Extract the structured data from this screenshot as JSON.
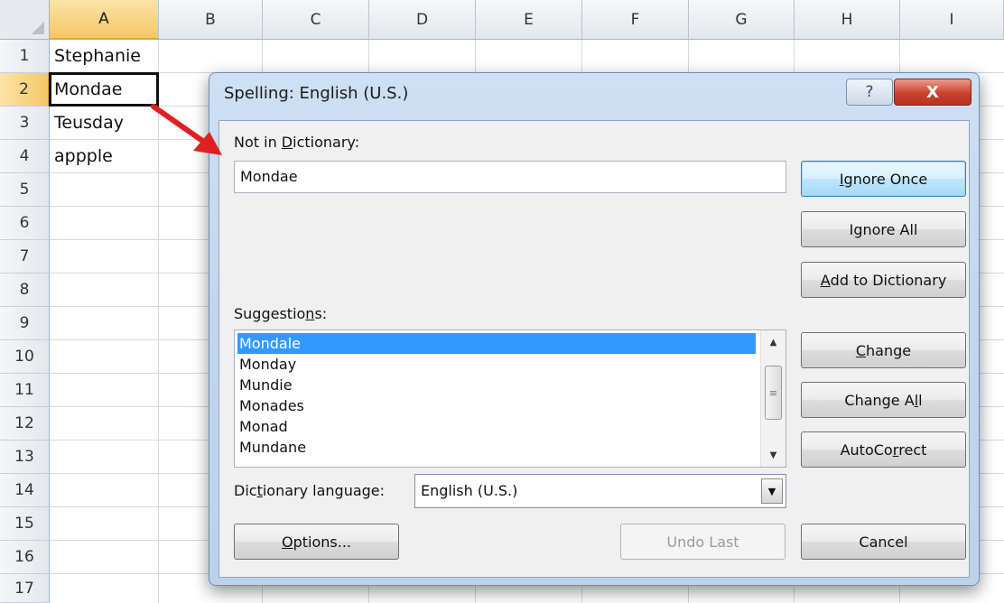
{
  "sheet": {
    "columns": [
      "A",
      "B",
      "C",
      "D",
      "E",
      "F",
      "G",
      "H",
      "I"
    ],
    "rows": [
      "1",
      "2",
      "3",
      "4",
      "5",
      "6",
      "7",
      "8",
      "9",
      "10",
      "11",
      "12",
      "13",
      "14",
      "15",
      "16",
      "17"
    ],
    "cells": {
      "a1": "Stephanie",
      "a2": "Mondae",
      "a3": "Teusday",
      "a4": "appple"
    }
  },
  "dialog": {
    "title": "Spelling: English (U.S.)",
    "help_glyph": "?",
    "close_glyph": "X",
    "not_in_dictionary_label": {
      "pre": "Not in ",
      "u": "D",
      "post": "ictionary:"
    },
    "not_in_dictionary_value": "Mondae",
    "suggestions_label": {
      "pre": "Suggestio",
      "u": "n",
      "post": "s:"
    },
    "suggestions": [
      "Mondale",
      "Monday",
      "Mundie",
      "Monades",
      "Monad",
      "Mundane"
    ],
    "selected_suggestion": "Mondale",
    "dictionary_language_label": {
      "pre": "Dic",
      "u": "t",
      "post": "ionary language:"
    },
    "dictionary_language_value": "English (U.S.)",
    "buttons": {
      "ignore_once": {
        "u": "I",
        "post": "gnore Once"
      },
      "ignore_all": {
        "pre": "I",
        "u": "g",
        "post": "nore All"
      },
      "add_to_dictionary": {
        "u": "A",
        "post": "dd to Dictionary"
      },
      "change": {
        "u": "C",
        "post": "hange"
      },
      "change_all": {
        "pre": "Change A",
        "u": "l",
        "post": "l"
      },
      "autocorrect": {
        "pre": "AutoCo",
        "u": "r",
        "post": "rect"
      },
      "options": {
        "u": "O",
        "post": "ptions..."
      },
      "undo_last": "Undo Last",
      "cancel": "Cancel"
    }
  },
  "colors": {
    "selection_blue": "#3399ff",
    "annotation_arrow": "#e02020",
    "header_active": "#f4c766"
  }
}
